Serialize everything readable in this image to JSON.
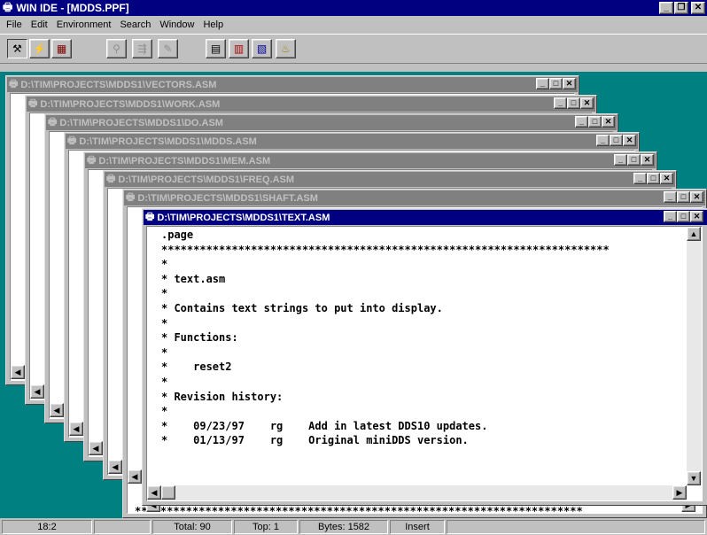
{
  "app": {
    "title": "WIN IDE - [MDDS.PPF]",
    "controls": [
      "minimize",
      "restore",
      "close"
    ]
  },
  "menu": [
    {
      "label": "File"
    },
    {
      "label": "Edit"
    },
    {
      "label": "Environment"
    },
    {
      "label": "Search"
    },
    {
      "label": "Window"
    },
    {
      "label": "Help"
    }
  ],
  "toolbar": {
    "buttons": [
      {
        "icon": "compass-icon",
        "glyph": "⚒"
      },
      {
        "icon": "lightning-icon",
        "glyph": "⚡"
      },
      {
        "icon": "project-icon",
        "glyph": "▦"
      },
      {
        "icon": "find-icon",
        "glyph": "⚲"
      },
      {
        "icon": "doc-arrow-icon",
        "glyph": "⇶"
      },
      {
        "icon": "doc-edit-icon",
        "glyph": "✎"
      },
      {
        "icon": "doc-icon",
        "glyph": "▤"
      },
      {
        "icon": "doc-red-icon",
        "glyph": "▥"
      },
      {
        "icon": "doc-blue-icon",
        "glyph": "▧"
      },
      {
        "icon": "bell-icon",
        "glyph": "♨"
      }
    ]
  },
  "windows": [
    {
      "title": "D:\\TIM\\PROJECTS\\MDDS1\\VECTORS.ASM"
    },
    {
      "title": "D:\\TIM\\PROJECTS\\MDDS1\\WORK.ASM"
    },
    {
      "title": "D:\\TIM\\PROJECTS\\MDDS1\\DO.ASM"
    },
    {
      "title": "D:\\TIM\\PROJECTS\\MDDS1\\MDDS.ASM"
    },
    {
      "title": "D:\\TIM\\PROJECTS\\MDDS1\\MEM.ASM"
    },
    {
      "title": "D:\\TIM\\PROJECTS\\MDDS1\\FREQ.ASM"
    },
    {
      "title": "D:\\TIM\\PROJECTS\\MDDS1\\SHAFT.ASM"
    },
    {
      "title": "D:\\TIM\\PROJECTS\\MDDS1\\TEXT.ASM"
    }
  ],
  "editor": {
    "lines": [
      ".page",
      "**********************************************************************",
      "*",
      "* text.asm",
      "*",
      "* Contains text strings to put into display.",
      "*",
      "* Functions:",
      "*",
      "*    reset2",
      "*",
      "* Revision history:",
      "*",
      "*    09/23/97    rg    Add in latest DDS10 updates.",
      "*    01/13/97    rg    Original miniDDS version."
    ],
    "shaft_visible_line": "**********************************************************************"
  },
  "status": {
    "position": "18:2",
    "blank": "",
    "total": "Total: 90",
    "top": "Top: 1",
    "bytes": "Bytes: 1582",
    "mode": "Insert"
  }
}
